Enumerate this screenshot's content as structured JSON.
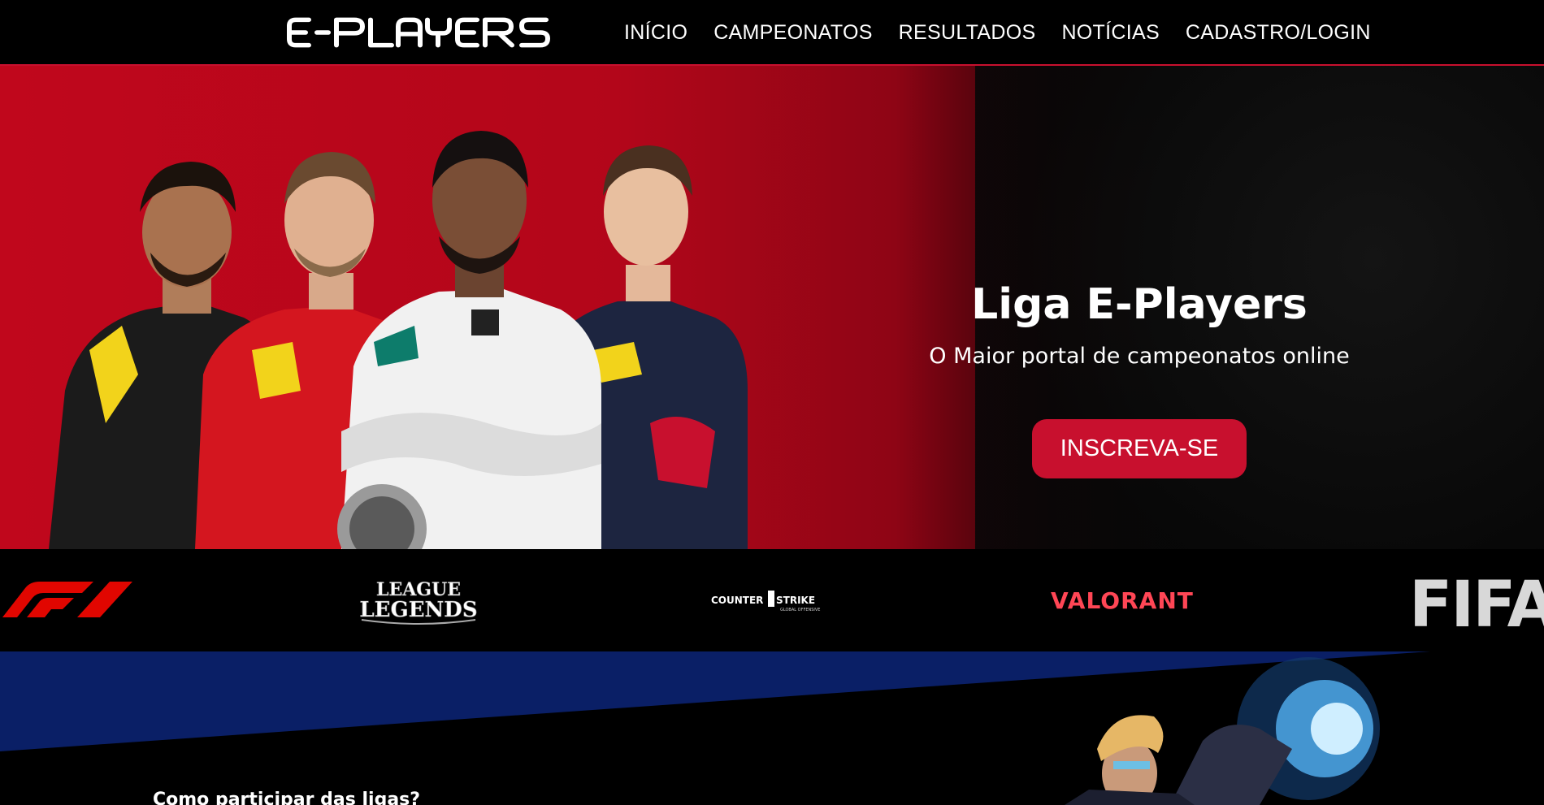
{
  "header": {
    "logo_text": "E-PLAYERS",
    "nav": [
      {
        "label": "INÍCIO"
      },
      {
        "label": "CAMPEONATOS"
      },
      {
        "label": "RESULTADOS"
      },
      {
        "label": "NOTÍCIAS"
      },
      {
        "label": "CADASTRO/LOGIN"
      }
    ]
  },
  "hero": {
    "title": "Liga E-Players",
    "subtitle": "O Maior portal de campeonatos online",
    "cta_label": "INSCREVA-SE"
  },
  "games": [
    {
      "name": "F1"
    },
    {
      "name": "LEAGUE OF LEGENDS"
    },
    {
      "name": "COUNTER STRIKE"
    },
    {
      "name": "VALORANT"
    },
    {
      "name": "FIFA"
    }
  ],
  "section": {
    "howto_title": "Como participar das ligas?"
  },
  "colors": {
    "accent": "#c8102e",
    "navy": "#0a1f66",
    "background": "#000000"
  }
}
